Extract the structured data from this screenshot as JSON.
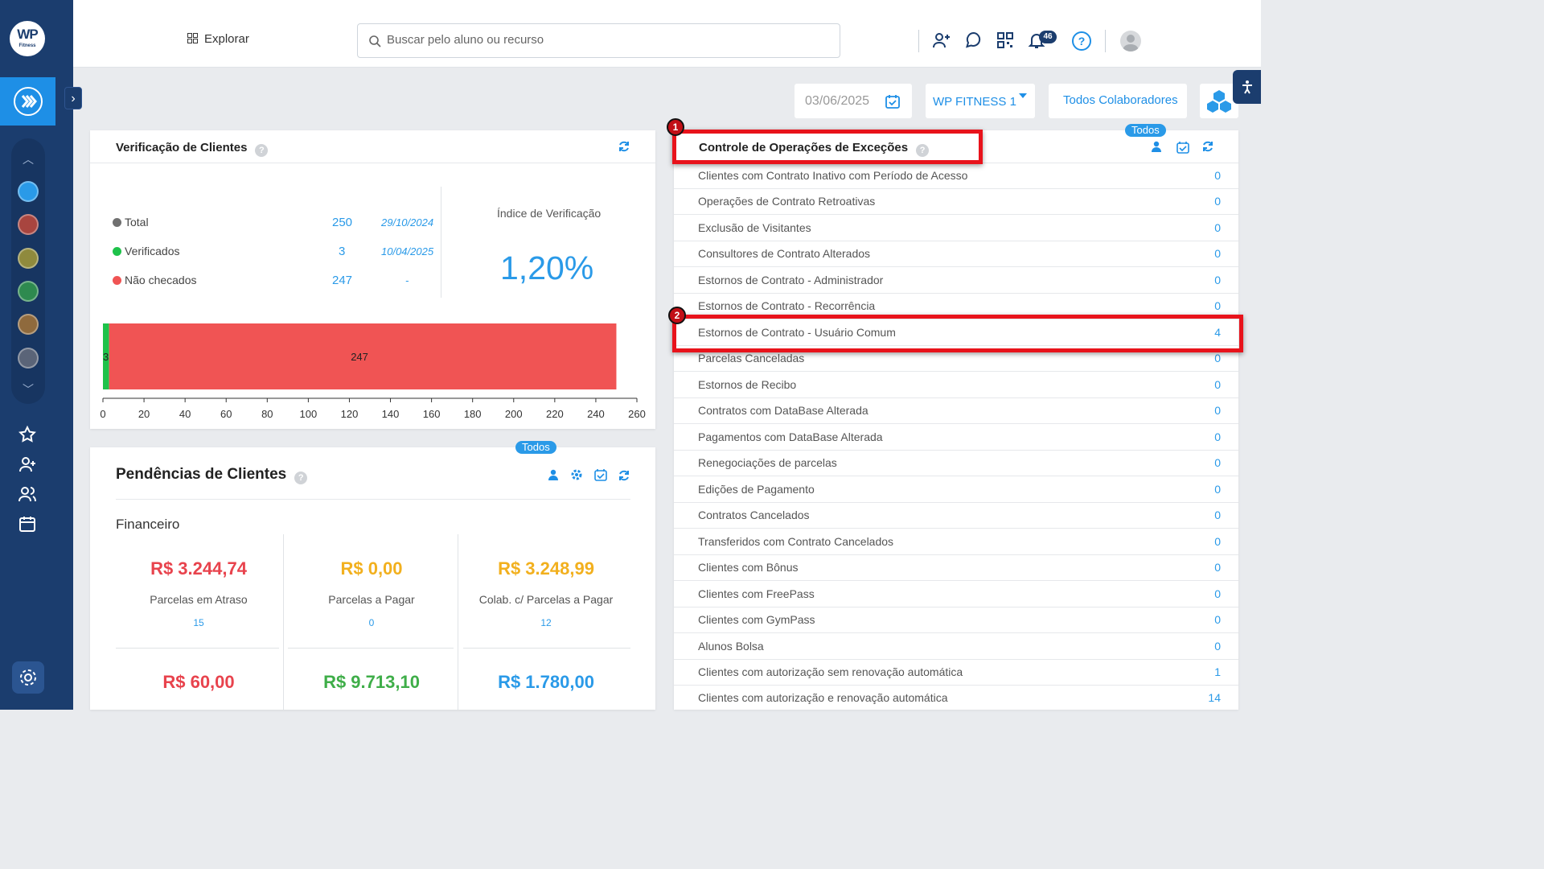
{
  "brand": {
    "logo_text": "WP",
    "logo_sub": "Fitness"
  },
  "topbar": {
    "explore_label": "Explorar",
    "search_placeholder": "Buscar pelo aluno ou recurso",
    "notifications_count": "46"
  },
  "filters": {
    "date": "03/06/2025",
    "company": "WP FITNESS 1",
    "collaborators": "Todos Colaboradores"
  },
  "verificacao": {
    "title": "Verificação de Clientes",
    "help": "?",
    "rows": [
      {
        "label": "Total",
        "value": "250",
        "date": "29/10/2024",
        "color": "#707070"
      },
      {
        "label": "Verificados",
        "value": "3",
        "date": "10/04/2025",
        "color": "#1ec24a"
      },
      {
        "label": "Não checados",
        "value": "247",
        "date": "-",
        "color": "#f05454"
      }
    ],
    "index_label": "Índice de Verificação",
    "index_value": "1,20%"
  },
  "chart_data": {
    "type": "bar",
    "orientation": "horizontal",
    "stacked": true,
    "series": [
      {
        "value": 3,
        "color": "#1ec24a",
        "label": "3"
      },
      {
        "value": 247,
        "color": "#f05454",
        "label": "247"
      }
    ],
    "xlim": [
      0,
      260
    ],
    "xticks": [
      0,
      20,
      40,
      60,
      80,
      100,
      120,
      140,
      160,
      180,
      200,
      220,
      240,
      260
    ]
  },
  "pendencias": {
    "title": "Pendências de Clientes",
    "help": "?",
    "todos_label": "Todos",
    "section": "Financeiro",
    "cards": [
      {
        "amount": "R$ 3.244,74",
        "label": "Parcelas em Atraso",
        "count": "15",
        "color": "#e8434d"
      },
      {
        "amount": "R$ 0,00",
        "label": "Parcelas a Pagar",
        "count": "0",
        "color": "#f2b01e"
      },
      {
        "amount": "R$ 3.248,99",
        "label": "Colab. c/ Parcelas a Pagar",
        "count": "12",
        "color": "#f2b01e"
      },
      {
        "amount": "R$ 60,00",
        "color": "#e8434d"
      },
      {
        "amount": "R$ 9.713,10",
        "color": "#3fae49"
      },
      {
        "amount": "R$ 1.780,00",
        "color": "#2a9ae8"
      }
    ]
  },
  "excecoes": {
    "title": "Controle de Operações de Exceções",
    "help": "?",
    "todos_label": "Todos",
    "rows": [
      {
        "label": "Clientes com Contrato Inativo com Período de Acesso",
        "value": "0"
      },
      {
        "label": "Operações de Contrato Retroativas",
        "value": "0"
      },
      {
        "label": "Exclusão de Visitantes",
        "value": "0"
      },
      {
        "label": "Consultores de Contrato Alterados",
        "value": "0"
      },
      {
        "label": "Estornos de Contrato - Administrador",
        "value": "0"
      },
      {
        "label": "Estornos de Contrato - Recorrência",
        "value": "0"
      },
      {
        "label": "Estornos de Contrato - Usuário Comum",
        "value": "4"
      },
      {
        "label": "Parcelas Canceladas",
        "value": "0"
      },
      {
        "label": "Estornos de Recibo",
        "value": "0"
      },
      {
        "label": "Contratos com DataBase Alterada",
        "value": "0"
      },
      {
        "label": "Pagamentos com DataBase Alterada",
        "value": "0"
      },
      {
        "label": "Renegociações de parcelas",
        "value": "0"
      },
      {
        "label": "Edições de Pagamento",
        "value": "0"
      },
      {
        "label": "Contratos Cancelados",
        "value": "0"
      },
      {
        "label": "Transferidos com Contrato Cancelados",
        "value": "0"
      },
      {
        "label": "Clientes com Bônus",
        "value": "0"
      },
      {
        "label": "Clientes com FreePass",
        "value": "0"
      },
      {
        "label": "Clientes com GymPass",
        "value": "0"
      },
      {
        "label": "Alunos Bolsa",
        "value": "0"
      },
      {
        "label": "Clientes com autorização sem renovação automática",
        "value": "1"
      },
      {
        "label": "Clientes com autorização e renovação automática",
        "value": "14"
      }
    ]
  },
  "annotations": {
    "marker1": "1",
    "marker2": "2"
  },
  "colors": {
    "accent": "#2a9ae8",
    "sidebar": "#1b3d6e",
    "highlight": "#e8131b"
  }
}
